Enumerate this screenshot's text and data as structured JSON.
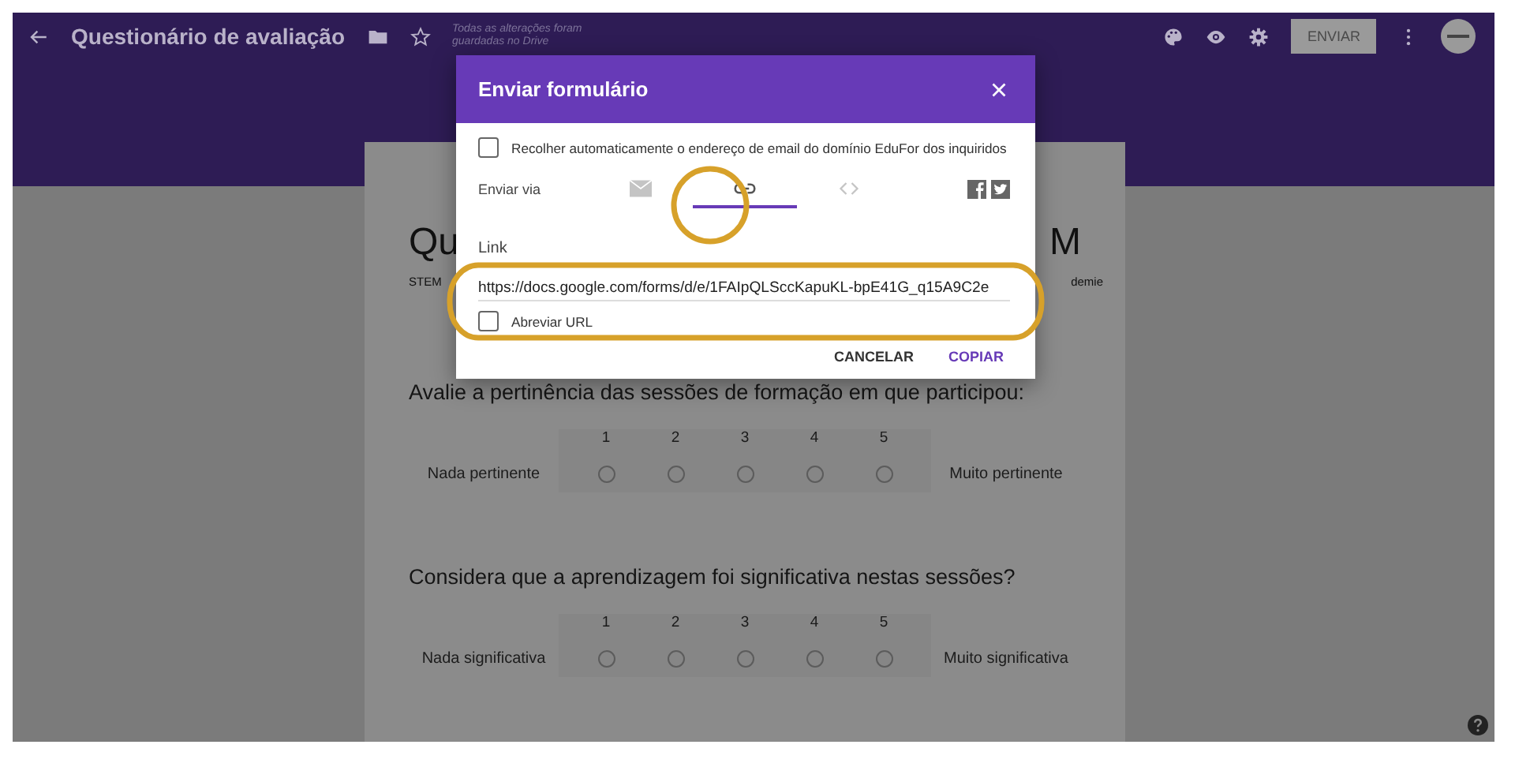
{
  "top_bar": {
    "title": "Questionário de avaliação",
    "save_status": "Todas as alterações foram guardadas no Drive",
    "send_button": "ENVIAR"
  },
  "form": {
    "title_start": "Qu",
    "title_end": "M",
    "description_start": "STEM",
    "description_end": "demie",
    "questions": [
      {
        "text": "Avalie a pertinência das sessões de formação em que participou:",
        "low_label": "Nada pertinente",
        "high_label": "Muito pertinente",
        "options": [
          {
            "label": "1",
            "selected": false
          },
          {
            "label": "2",
            "selected": false
          },
          {
            "label": "3",
            "selected": false
          },
          {
            "label": "4",
            "selected": false
          },
          {
            "label": "5",
            "selected": false
          }
        ]
      },
      {
        "text": "Considera que a aprendizagem foi significativa nestas sessões?",
        "low_label": "Nada significativa",
        "high_label": "Muito significativa",
        "options": [
          {
            "label": "1",
            "selected": false
          },
          {
            "label": "2",
            "selected": false
          },
          {
            "label": "3",
            "selected": false
          },
          {
            "label": "4",
            "selected": false
          },
          {
            "label": "5",
            "selected": false
          }
        ]
      }
    ]
  },
  "dialog": {
    "title": "Enviar formulário",
    "collect_email": {
      "label": "Recolher automaticamente o endereço de email do domínio EduFor dos inquiridos",
      "checked": false
    },
    "send_via_label": "Enviar via",
    "send_tabs": [
      {
        "kind": "email",
        "selected": false
      },
      {
        "kind": "link",
        "selected": true
      },
      {
        "kind": "embed",
        "selected": false
      }
    ],
    "section_title": "Link",
    "url": "https://docs.google.com/forms/d/e/1FAIpQLSccKapuKL-bpE41G_q15A9C2e",
    "shorten_url": {
      "label": "Abreviar URL",
      "checked": false
    },
    "buttons": [
      {
        "label": "CANCELAR",
        "kind": "cancel"
      },
      {
        "label": "COPIAR",
        "kind": "primary"
      }
    ]
  }
}
